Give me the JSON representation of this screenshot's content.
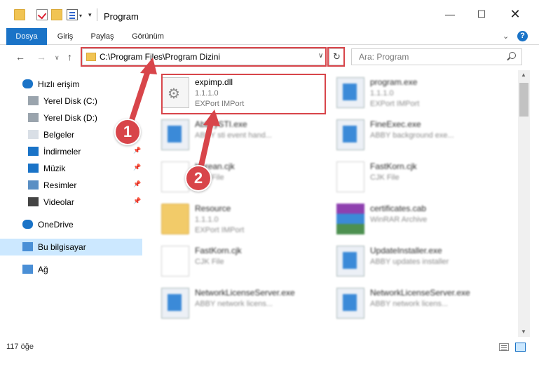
{
  "window": {
    "title": "Program",
    "min_glyph": "—",
    "max_glyph": "☐",
    "close_glyph": "✕"
  },
  "quick_access_toolbar": {
    "dropdown_glyph": "▾",
    "customize_glyph": "▾"
  },
  "ribbon": {
    "tabs": [
      "Dosya",
      "Giriş",
      "Paylaş",
      "Görünüm"
    ],
    "active_tab": "Dosya",
    "accent": "#1a73c7",
    "collapse_glyph": "⌄",
    "help_label": "?"
  },
  "nav": {
    "back_glyph": "←",
    "forward_glyph": "→",
    "recent_glyph": "∨",
    "up_glyph": "↑",
    "address": "C:\\Program Files\\Program Dizini",
    "address_dropdown_glyph": "∨",
    "refresh_glyph": "↻",
    "search_placeholder": "Ara: Program"
  },
  "sidebar": {
    "items": [
      {
        "label": "Hızlı erişim",
        "icon": "star-icon",
        "pinned": false
      },
      {
        "label": "Yerel Disk (C:)",
        "icon": "drive-icon",
        "pinned": false
      },
      {
        "label": "Yerel Disk (D:)",
        "icon": "drive-icon",
        "pinned": false
      },
      {
        "label": "Belgeler",
        "icon": "documents-icon",
        "pinned": true
      },
      {
        "label": "İndirmeler",
        "icon": "download-icon",
        "pinned": true
      },
      {
        "label": "Müzik",
        "icon": "music-icon",
        "pinned": true
      },
      {
        "label": "Resimler",
        "icon": "pictures-icon",
        "pinned": true
      },
      {
        "label": "Videolar",
        "icon": "video-icon",
        "pinned": true
      },
      {
        "label": "OneDrive",
        "icon": "cloud-icon",
        "pinned": false
      },
      {
        "label": "Bu bilgisayar",
        "icon": "computer-icon",
        "pinned": false,
        "selected": true
      },
      {
        "label": "Ağ",
        "icon": "network-icon",
        "pinned": false
      }
    ],
    "pin_glyph": "📌"
  },
  "files": [
    {
      "name": "expimp.dll",
      "line1": "1.1.1.0",
      "line2": "EXPort IMPort",
      "icon": "gear-file-icon",
      "blurred": false,
      "highlighted": true
    },
    {
      "name": "program.exe",
      "line1": "1.1.1.0",
      "line2": "EXPort IMPort",
      "icon": "app-icon",
      "blurred": true
    },
    {
      "name": "AbbyySTI.exe",
      "line1": "ABBY sti event hand...",
      "line2": "",
      "icon": "app-icon",
      "blurred": true
    },
    {
      "name": "FineExec.exe",
      "line1": "ABBY background exe...",
      "line2": "",
      "icon": "app-icon",
      "blurred": true
    },
    {
      "name": "Korean.cjk",
      "line1": "CJK File",
      "line2": "",
      "icon": "document-icon",
      "blurred": true
    },
    {
      "name": "FastKorn.cjk",
      "line1": "CJK File",
      "line2": "",
      "icon": "document-icon",
      "blurred": true
    },
    {
      "name": "Resource",
      "line1": "1.1.1.0",
      "line2": "EXPort IMPort",
      "icon": "folder-icon",
      "blurred": true
    },
    {
      "name": "certificates.cab",
      "line1": "WinRAR Archive",
      "line2": "",
      "icon": "rar-icon",
      "blurred": true
    },
    {
      "name": "FastKorn.cjk",
      "line1": "CJK File",
      "line2": "",
      "icon": "document-icon",
      "blurred": true
    },
    {
      "name": "UpdateInstaller.exe",
      "line1": "ABBY updates installer",
      "line2": "",
      "icon": "app-icon",
      "blurred": true
    },
    {
      "name": "NetworkLicenseServer.exe",
      "line1": "ABBY network licens...",
      "line2": "",
      "icon": "app-icon",
      "blurred": true
    },
    {
      "name": "NetworkLicenseServer.exe",
      "line1": "ABBY network licens...",
      "line2": "",
      "icon": "app-icon",
      "blurred": true
    }
  ],
  "status": {
    "item_count": "117 öğe"
  },
  "annotations": {
    "badge1": "1",
    "badge2": "2",
    "highlight_color": "#d8454a"
  }
}
